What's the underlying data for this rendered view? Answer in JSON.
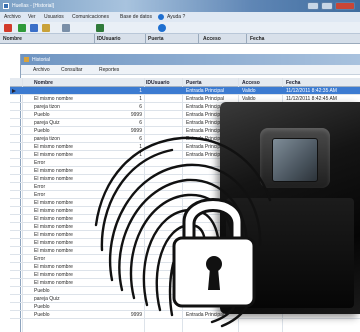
{
  "window": {
    "title": "Huellas - [Historial]"
  },
  "menu": {
    "items": [
      "Archivo",
      "Ver",
      "Usuarios",
      "Comunicaciones",
      "Base de datos",
      "Ayuda ?"
    ]
  },
  "outer_columns": [
    "Nombre",
    "IDUsuario",
    "Puerta",
    "Acceso",
    "Fecha"
  ],
  "child": {
    "title": "Historial",
    "menu": [
      "Archivo",
      "Consultar",
      "Reportes"
    ]
  },
  "grid": {
    "columns": [
      "Nombre",
      "IDUsuario",
      "Puerta",
      "Acceso",
      "Fecha"
    ],
    "rows": [
      {
        "nombre": "",
        "id": "1",
        "puerta": "Entrada Principal",
        "acceso": "Valido",
        "fecha": "11/12/2011 8:42:35 AM",
        "selected": true
      },
      {
        "nombre": "El mismo nombre",
        "id": "1",
        "puerta": "Entrada Principal",
        "acceso": "Valido",
        "fecha": "11/12/2011 8:42:45 AM"
      },
      {
        "nombre": "pareja tizon",
        "id": "6",
        "puerta": "Entrada Principal",
        "acceso": "",
        "fecha": ""
      },
      {
        "nombre": "Pueblo",
        "id": "9999",
        "puerta": "Entrada Principal",
        "acceso": "",
        "fecha": ""
      },
      {
        "nombre": "pareja Quiz",
        "id": "6",
        "puerta": "Entrada Principal",
        "acceso": "",
        "fecha": ""
      },
      {
        "nombre": "Pueblo",
        "id": "9999",
        "puerta": "Entrada Principal",
        "acceso": "",
        "fecha": ""
      },
      {
        "nombre": "pareja tizon",
        "id": "6",
        "puerta": "Entrada Principal",
        "acceso": "",
        "fecha": ""
      },
      {
        "nombre": "El mismo nombre",
        "id": "1",
        "puerta": "Entrada Principal",
        "acceso": "",
        "fecha": ""
      },
      {
        "nombre": "El mismo nombre",
        "id": "1",
        "puerta": "Entrada Principal",
        "acceso": "",
        "fecha": ""
      },
      {
        "nombre": "Error",
        "id": "",
        "puerta": "",
        "acceso": "",
        "fecha": ""
      },
      {
        "nombre": "El mismo nombre",
        "id": "",
        "puerta": "",
        "acceso": "",
        "fecha": ""
      },
      {
        "nombre": "El mismo nombre",
        "id": "",
        "puerta": "",
        "acceso": "",
        "fecha": ""
      },
      {
        "nombre": "Error",
        "id": "",
        "puerta": "",
        "acceso": "",
        "fecha": ""
      },
      {
        "nombre": "Error",
        "id": "",
        "puerta": "",
        "acceso": "",
        "fecha": ""
      },
      {
        "nombre": "El mismo nombre",
        "id": "",
        "puerta": "",
        "acceso": "",
        "fecha": ""
      },
      {
        "nombre": "El mismo nombre",
        "id": "",
        "puerta": "",
        "acceso": "",
        "fecha": ""
      },
      {
        "nombre": "El mismo nombre",
        "id": "",
        "puerta": "",
        "acceso": "",
        "fecha": ""
      },
      {
        "nombre": "El mismo nombre",
        "id": "",
        "puerta": "",
        "acceso": "",
        "fecha": ""
      },
      {
        "nombre": "El mismo nombre",
        "id": "",
        "puerta": "",
        "acceso": "",
        "fecha": ""
      },
      {
        "nombre": "El mismo nombre",
        "id": "",
        "puerta": "",
        "acceso": "",
        "fecha": ""
      },
      {
        "nombre": "El mismo nombre",
        "id": "",
        "puerta": "",
        "acceso": "",
        "fecha": ""
      },
      {
        "nombre": "Error",
        "id": "",
        "puerta": "",
        "acceso": "",
        "fecha": ""
      },
      {
        "nombre": "El mismo nombre",
        "id": "",
        "puerta": "",
        "acceso": "",
        "fecha": ""
      },
      {
        "nombre": "El mismo nombre",
        "id": "",
        "puerta": "",
        "acceso": "",
        "fecha": ""
      },
      {
        "nombre": "El mismo nombre",
        "id": "",
        "puerta": "",
        "acceso": "",
        "fecha": ""
      },
      {
        "nombre": "Pueblo",
        "id": "",
        "puerta": "",
        "acceso": "",
        "fecha": ""
      },
      {
        "nombre": "pareja Quiz",
        "id": "",
        "puerta": "",
        "acceso": "",
        "fecha": ""
      },
      {
        "nombre": "Pueblo",
        "id": "",
        "puerta": "",
        "acceso": "",
        "fecha": ""
      },
      {
        "nombre": "Pueblo",
        "id": "9999",
        "puerta": "Entrada Principal",
        "acceso": "",
        "fecha": ""
      }
    ]
  },
  "colors": {
    "selection": "#3c7bd1",
    "titlebar": "#5f86b5",
    "device": "#0d0d0d"
  }
}
